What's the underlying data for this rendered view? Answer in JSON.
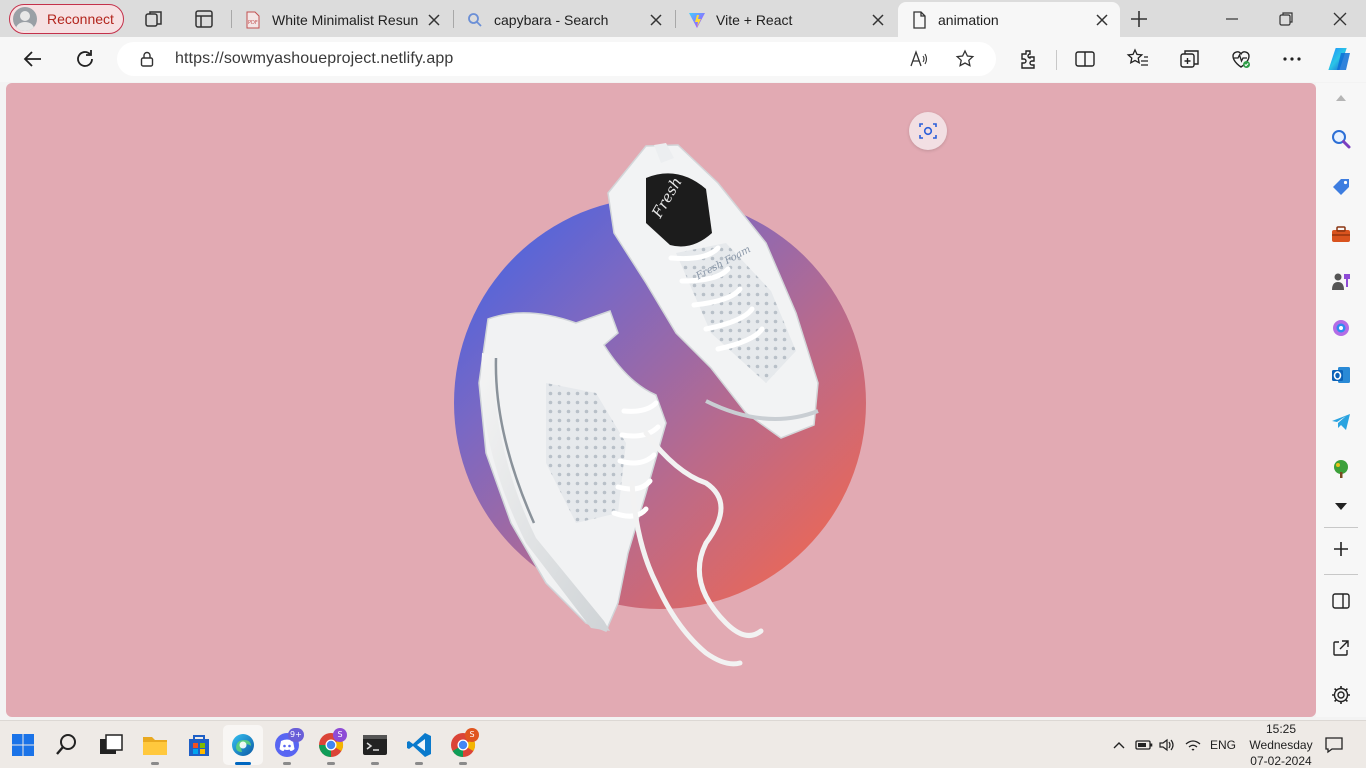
{
  "browser": {
    "profile_button": {
      "label": "Reconnect"
    },
    "tabs": [
      {
        "title": "White Minimalist Resun",
        "icon": "pdf-icon",
        "active": false
      },
      {
        "title": "capybara - Search",
        "icon": "search-icon",
        "active": false
      },
      {
        "title": "Vite + React",
        "icon": "vite-icon",
        "active": false
      },
      {
        "title": "animation",
        "icon": "page-icon",
        "active": true
      }
    ],
    "address_bar": {
      "url": "https://sowmyashoueproject.netlify.app"
    },
    "sidebar_icons": [
      "search-icon",
      "shopping-icon",
      "tools-icon",
      "games-icon",
      "copilot-icon",
      "outlook-icon",
      "telegram-icon",
      "tree-icon",
      "customize-dropdown-icon",
      "add-icon",
      "split-screen-icon",
      "external-link-icon",
      "settings-icon"
    ]
  },
  "page": {
    "title": "animation",
    "colors": {
      "background": "#e2aab3",
      "gradient_start": "#3a63ea",
      "gradient_end": "#fc6744"
    },
    "image": {
      "subject": "pair of white sneakers",
      "print": "Fresh Foam"
    }
  },
  "taskbar": {
    "apps": [
      "start-icon",
      "search-icon",
      "task-view-icon",
      "file-explorer-icon",
      "store-icon",
      "edge-icon",
      "discord-icon",
      "chrome-icon",
      "terminal-icon",
      "vscode-icon",
      "chrome-profile-icon"
    ],
    "discord_badge": "9+",
    "chrome_badge": "S",
    "chrome_profile_badge": "S",
    "tray": {
      "language": "ENG"
    },
    "clock": {
      "time": "15:25",
      "day": "Wednesday",
      "date": "07-02-2024"
    }
  }
}
